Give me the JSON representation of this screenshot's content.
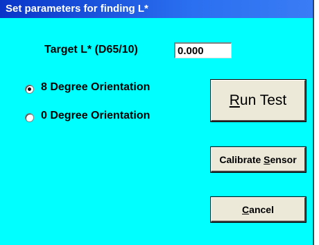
{
  "window": {
    "title": "Set parameters for finding L*"
  },
  "target": {
    "label": "Target L* (D65/10)",
    "value": "0.000"
  },
  "orientation": {
    "options": [
      {
        "label": "8 Degree Orientation",
        "selected": true
      },
      {
        "label": "0 Degree Orientation",
        "selected": false
      }
    ]
  },
  "buttons": {
    "run_test": {
      "pre": "",
      "mnemonic": "R",
      "post": "un Test"
    },
    "calibrate": {
      "pre": "Calibrate ",
      "mnemonic": "S",
      "post": "ensor"
    },
    "cancel": {
      "pre": "",
      "mnemonic": "C",
      "post": "ancel"
    }
  },
  "colors": {
    "background": "#00ffff",
    "titlebar": "#2a6ff0",
    "button_face": "#ece9d8"
  }
}
